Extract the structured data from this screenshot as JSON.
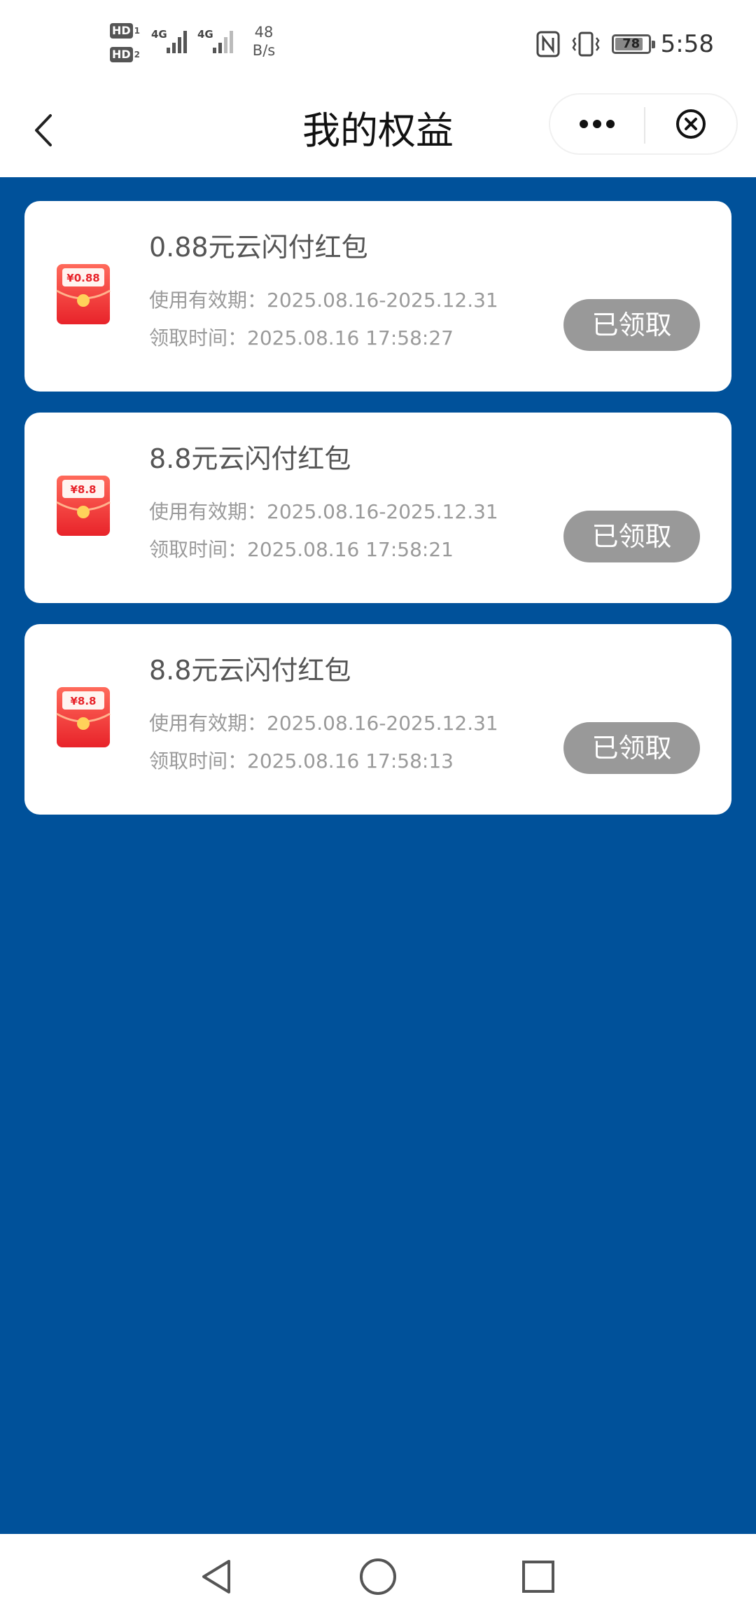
{
  "status_bar": {
    "hd1": "HD",
    "hd1_sub": "1",
    "hd2": "HD",
    "hd2_sub": "2",
    "net1": "4G",
    "net2": "4G",
    "speed_value": "48",
    "speed_unit": "B/s",
    "battery": "78",
    "time": "5:58"
  },
  "header": {
    "title": "我的权益",
    "back_icon": "chevron-left-icon",
    "more_icon": "more-dots-icon",
    "close_icon": "close-circle-icon"
  },
  "colors": {
    "content_bg": "#00519a",
    "card_bg": "#ffffff",
    "claimed_button_bg": "#999999",
    "envelope_red": "#f0383b"
  },
  "cards": [
    {
      "title": "0.88元云闪付红包",
      "validity": "使用有效期：2025.08.16-2025.12.31",
      "claim_time": "领取时间：2025.08.16 17:58:27",
      "badge": "¥0.88",
      "status": "已领取"
    },
    {
      "title": "8.8元云闪付红包",
      "validity": "使用有效期：2025.08.16-2025.12.31",
      "claim_time": "领取时间：2025.08.16 17:58:21",
      "badge": "¥8.8",
      "status": "已领取"
    },
    {
      "title": "8.8元云闪付红包",
      "validity": "使用有效期：2025.08.16-2025.12.31",
      "claim_time": "领取时间：2025.08.16 17:58:13",
      "badge": "¥8.8",
      "status": "已领取"
    }
  ],
  "nav": {
    "back_icon": "triangle-back-icon",
    "home_icon": "circle-home-icon",
    "recents_icon": "square-recents-icon"
  }
}
